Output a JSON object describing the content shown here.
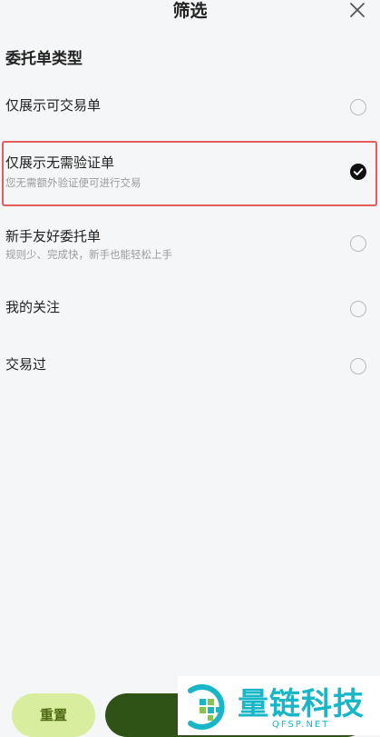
{
  "header": {
    "title": "筛选",
    "close_icon": "close-icon"
  },
  "section": {
    "title": "委托单类型"
  },
  "options": [
    {
      "label": "仅展示可交易单",
      "subtitle": "",
      "checked": false
    },
    {
      "label": "仅展示无需验证单",
      "subtitle": "您无需额外验证便可进行交易",
      "checked": true
    },
    {
      "label": "新手友好委托单",
      "subtitle": "规则少、完成快，新手也能轻松上手",
      "checked": false
    },
    {
      "label": "我的关注",
      "subtitle": "",
      "checked": false
    },
    {
      "label": "交易过",
      "subtitle": "",
      "checked": false
    }
  ],
  "footer": {
    "reset_label": "重置",
    "confirm_label": ""
  },
  "watermark": {
    "text": "量链科技",
    "url": "QFSP.NET"
  },
  "colors": {
    "accent_light": "#d8ee9e",
    "accent_dark": "#2f5316",
    "highlight": "#e45d5d",
    "watermark": "#19b6c8"
  }
}
